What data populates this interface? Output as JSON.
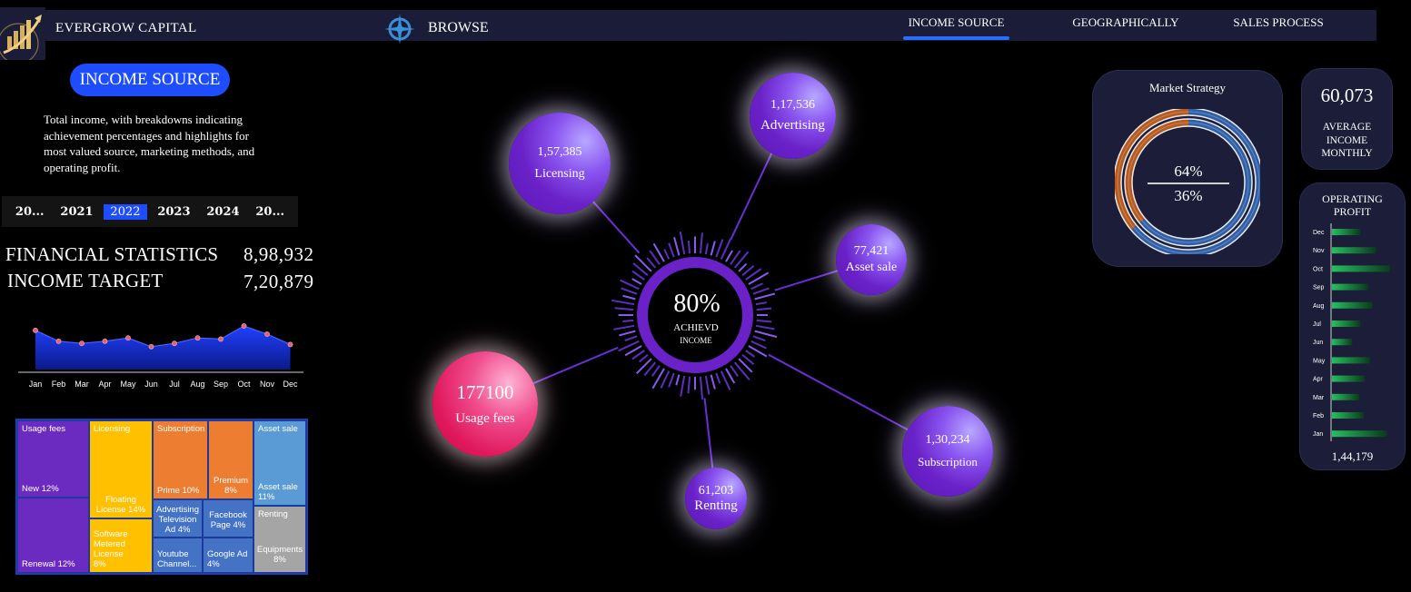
{
  "header": {
    "brand": "EVERGROW CAPITAL",
    "browse": "BROWSE",
    "nav": [
      {
        "label": "INCOME SOURCE",
        "active": true
      },
      {
        "label": "GEOGRAPHICALLY",
        "active": false
      },
      {
        "label": "SALES PROCESS",
        "active": false
      }
    ],
    "icons": [
      "growth-logo-icon",
      "compass-icon"
    ],
    "accent_color": "#2a6cff"
  },
  "left": {
    "section_title": "INCOME SOURCE",
    "description": "Total income, with breakdowns indicating achievement percentages and highlights for most valued source, marketing methods, and operating profit.",
    "years": [
      "20...",
      "2021",
      "2022",
      "2023",
      "2024",
      "20..."
    ],
    "selected_year": "2022",
    "stats": [
      {
        "label": "FINANCIAL STATISTICS",
        "value": "8,98,932"
      },
      {
        "label": "INCOME TARGET",
        "value": "7,20,879"
      }
    ]
  },
  "chart_data": [
    {
      "type": "area",
      "categories": [
        "Jan",
        "Feb",
        "Mar",
        "Apr",
        "May",
        "Jun",
        "Jul",
        "Aug",
        "Sep",
        "Oct",
        "Nov",
        "Dec"
      ],
      "values": [
        72,
        52,
        48,
        52,
        58,
        42,
        48,
        58,
        56,
        80,
        65,
        46
      ],
      "ylim": [
        0,
        100
      ],
      "color": "#1e3dff",
      "marker_color": "#e0607a"
    },
    {
      "type": "bar",
      "title": "OPERATING PROFIT",
      "categories": [
        "Dec",
        "Nov",
        "Oct",
        "Sep",
        "Aug",
        "Jul",
        "Jun",
        "May",
        "Apr",
        "Mar",
        "Feb",
        "Jan"
      ],
      "values": [
        32,
        50,
        66,
        41,
        46,
        32,
        23,
        43,
        37,
        31,
        36,
        62
      ],
      "xlim": [
        0,
        70
      ],
      "total_label": "1,44,179",
      "color": "#1fae55"
    },
    {
      "type": "pie",
      "title": "Market Strategy",
      "labels": [
        "64%",
        "36%"
      ],
      "values": [
        64,
        36
      ],
      "colors": [
        "#2f5fa8",
        "#b85a1e"
      ]
    }
  ],
  "treemap": [
    {
      "label": "Usage fees",
      "sub": "New 12%",
      "color": "#6b2bc0"
    },
    {
      "label": "",
      "sub": "Renewal 12%",
      "color": "#6b2bc0"
    },
    {
      "label": "Licensing",
      "sub": "Floating License 14%",
      "color": "#ffc000"
    },
    {
      "label": "",
      "sub": "Software Metered License 8%",
      "color": "#ffc000"
    },
    {
      "label": "Subscription",
      "sub": "Prime 10%",
      "color": "#ed7d31"
    },
    {
      "label": "",
      "sub": "Premium 8%",
      "color": "#ed7d31"
    },
    {
      "label": "Advertising Television Ad 4%",
      "sub": "",
      "color": "#4472c4"
    },
    {
      "label": "Facebook Page 4%",
      "sub": "",
      "color": "#4472c4"
    },
    {
      "label": "Youtube Channel...",
      "sub": "",
      "color": "#4472c4"
    },
    {
      "label": "Google Ad 4%",
      "sub": "",
      "color": "#4472c4"
    },
    {
      "label": "Asset sale",
      "sub": "Asset sale 11%",
      "color": "#5b9bd5"
    },
    {
      "label": "Renting",
      "sub": "Equipments 8%",
      "color": "#a5a5a5"
    }
  ],
  "hub": {
    "percent": "80%",
    "label1": "ACHIEVD",
    "label2": "INCOME",
    "ring_color": "#6a22c8"
  },
  "bubbles": [
    {
      "name": "licensing",
      "value": "1,57,385",
      "label": "Licensing"
    },
    {
      "name": "advertising",
      "value": "1,17,536",
      "label": "Advertising"
    },
    {
      "name": "asset-sale",
      "value": "77,421",
      "label": "Asset sale"
    },
    {
      "name": "usage-fees",
      "value": "177100",
      "label": "Usage fees"
    },
    {
      "name": "subscription",
      "value": "1,30,234",
      "label": "Subscription"
    },
    {
      "name": "renting",
      "value": "61,203",
      "label": "Renting"
    }
  ],
  "right": {
    "strategy_title": "Market Strategy",
    "avg_value": "60,073",
    "avg_label": "AVERAGE INCOME MONTHLY",
    "op_title": "OPERATING PROFIT",
    "op_total": "1,44,179"
  }
}
